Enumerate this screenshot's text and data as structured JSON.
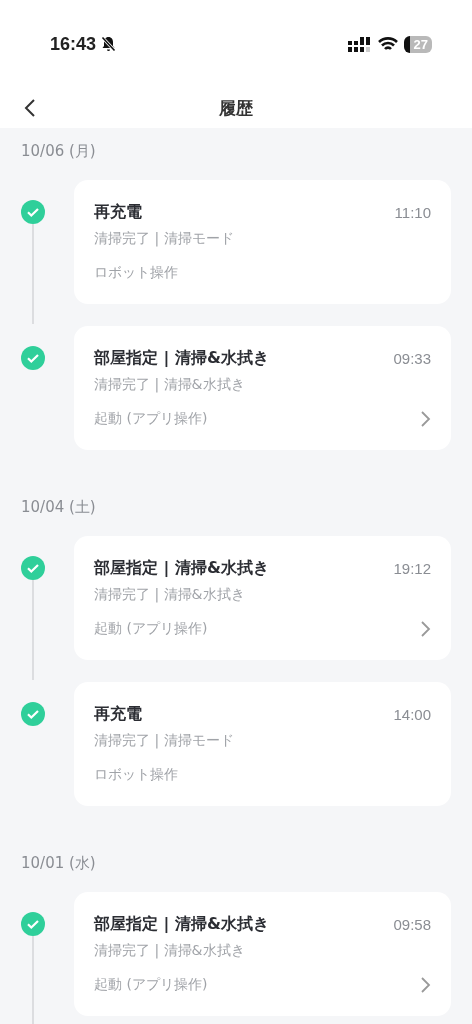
{
  "status_bar": {
    "time": "16:43",
    "battery": "27"
  },
  "header": {
    "title": "履歴"
  },
  "groups": [
    {
      "date": "10/06 (月)",
      "entries": [
        {
          "title": "再充電",
          "time": "11:10",
          "detail": "清掃完了 | 清掃モード",
          "source": "ロボット操作",
          "done": true,
          "has_details": false
        },
        {
          "title": "部屋指定 | 清掃&水拭き",
          "time": "09:33",
          "detail": "清掃完了 | 清掃&水拭き",
          "source": "起動 (アプリ操作)",
          "done": true,
          "has_details": true
        }
      ]
    },
    {
      "date": "10/04 (土)",
      "entries": [
        {
          "title": "部屋指定 | 清掃&水拭き",
          "time": "19:12",
          "detail": "清掃完了 | 清掃&水拭き",
          "source": "起動 (アプリ操作)",
          "done": true,
          "has_details": true
        },
        {
          "title": "再充電",
          "time": "14:00",
          "detail": "清掃完了 | 清掃モード",
          "source": "ロボット操作",
          "done": true,
          "has_details": false
        }
      ]
    },
    {
      "date": "10/01 (水)",
      "entries": [
        {
          "title": "部屋指定 | 清掃&水拭き",
          "time": "09:58",
          "detail": "清掃完了 | 清掃&水拭き",
          "source": "起動 (アプリ操作)",
          "done": true,
          "has_details": true
        }
      ]
    }
  ]
}
